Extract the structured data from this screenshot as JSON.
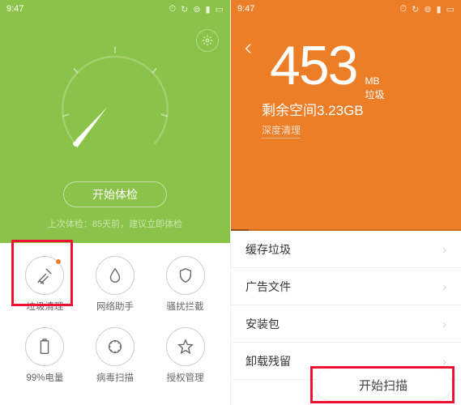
{
  "status": {
    "time": "9:47"
  },
  "left": {
    "start_button": "开始体检",
    "last_check": "上次体检：85天前，建议立即体检",
    "tools": [
      {
        "label": "垃圾清理",
        "icon": "trash-clean",
        "dot": true
      },
      {
        "label": "网络助手",
        "icon": "network"
      },
      {
        "label": "骚扰拦截",
        "icon": "shield"
      },
      {
        "label": "99%电量",
        "icon": "battery"
      },
      {
        "label": "病毒扫描",
        "icon": "virus"
      },
      {
        "label": "授权管理",
        "icon": "star"
      }
    ]
  },
  "right": {
    "number": "453",
    "unit_top": "MB",
    "unit_bottom": "垃圾",
    "space_free": "剩余空间3.23GB",
    "deep_clean": "深度清理",
    "rows": [
      "缓存垃圾",
      "广告文件",
      "安装包",
      "卸载残留"
    ],
    "scan_button": "开始扫描"
  },
  "colors": {
    "green": "#8bc34a",
    "orange": "#ec7e28",
    "highlight": "#e13"
  }
}
